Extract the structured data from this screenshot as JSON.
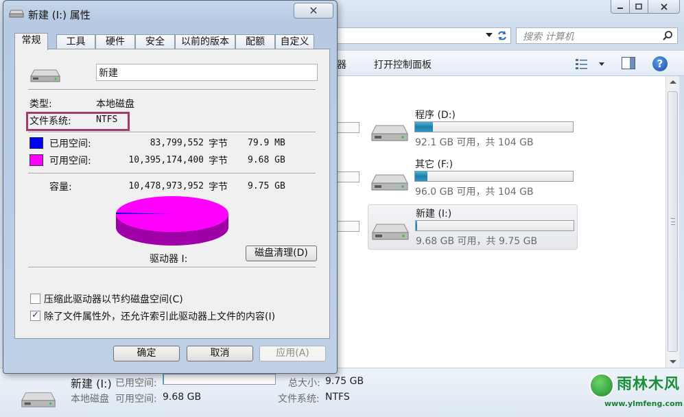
{
  "explorer": {
    "search_placeholder": "搜索 计算机",
    "toolbar": {
      "partial_label": "器",
      "control_panel_label": "打开控制面板",
      "help_icon": "?"
    },
    "drives": [
      {
        "name": "程序 (D:)",
        "free_text": "92.1 GB 可用，共 104 GB",
        "used_fraction": 0.115
      },
      {
        "name": "其它 (F:)",
        "free_text": "96.0 GB 可用，共 104 GB",
        "used_fraction": 0.077
      },
      {
        "name": "新建 (I:)",
        "free_text": "9.68 GB 可用，共 9.75 GB",
        "used_fraction": 0.008,
        "selected": true
      }
    ],
    "details": {
      "name": "新建 (I:)",
      "type": "本地磁盘",
      "used_label": "已用空间:",
      "free_label": "可用空间:",
      "free_value": "9.68 GB",
      "total_label": "总大小:",
      "total_value": "9.75 GB",
      "fs_label": "文件系统:",
      "fs_value": "NTFS",
      "used_fraction": 0.008
    }
  },
  "dialog": {
    "title": "新建 (I:) 属性",
    "close_symbol": "✕",
    "tabs": [
      "常规",
      "工具",
      "硬件",
      "安全",
      "以前的版本",
      "配额",
      "自定义"
    ],
    "active_tab": "常规",
    "drive_name": "新建",
    "type_label": "类型:",
    "type_value": "本地磁盘",
    "fs_label": "文件系统:",
    "fs_value": "NTFS",
    "used_label": "已用空间:",
    "used_bytes": "83,799,552",
    "used_size": "79.9 MB",
    "free_label": "可用空间:",
    "free_bytes": "10,395,174,400",
    "free_size": "9.68 GB",
    "capacity_label": "容量:",
    "capacity_bytes": "10,478,973,952",
    "capacity_size": "9.75 GB",
    "bytes_unit": "字节",
    "drive_letter_label": "驱动器 I:",
    "cleanup_button": "磁盘清理(D)",
    "compress_label": "压缩此驱动器以节约磁盘空间(C)",
    "compress_checked": false,
    "index_label": "除了文件属性外，还允许索引此驱动器上文件的内容(I)",
    "index_checked": true,
    "ok_button": "确定",
    "cancel_button": "取消",
    "apply_button": "应用(A)",
    "used_fraction": 0.008,
    "colors": {
      "used": "#0000ff",
      "free": "#ff00ff",
      "free_dark": "#a000a8"
    }
  },
  "watermark": {
    "title": "雨林木风",
    "url": "www.ylmfeng.com"
  }
}
